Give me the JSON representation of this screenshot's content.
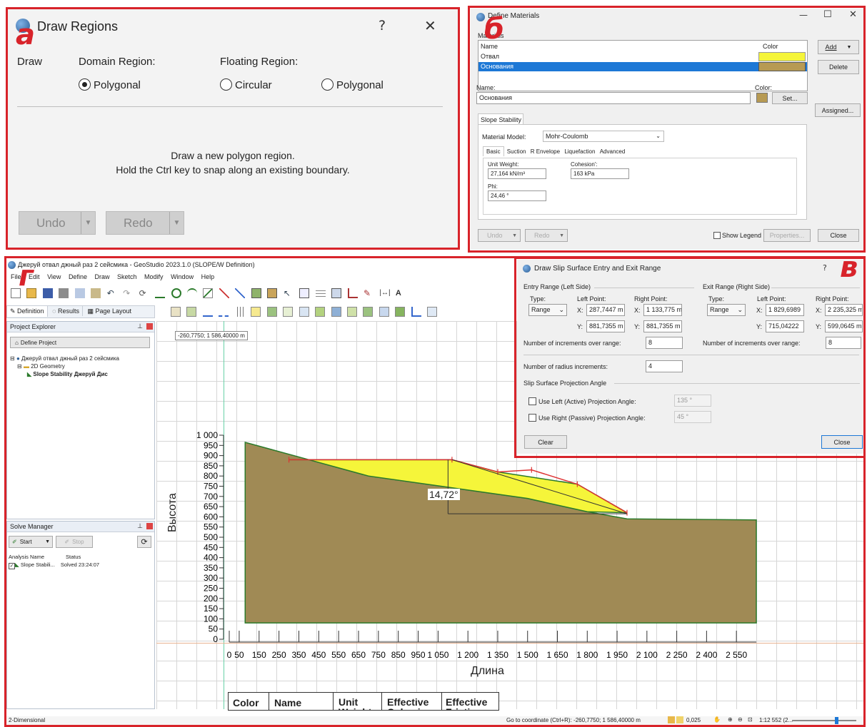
{
  "markers": {
    "a": "а",
    "b": "б",
    "g": "г",
    "v": "в"
  },
  "draw_regions": {
    "title": "Draw Regions",
    "help": "?",
    "close": "✕",
    "draw_label": "Draw",
    "domain_label": "Domain Region:",
    "floating_label": "Floating Region:",
    "opt_domain_polygonal": "Polygonal",
    "opt_circular": "Circular",
    "opt_floating_polygonal": "Polygonal",
    "selected": "domain_polygonal",
    "msg_line1": "Draw a new polygon region.",
    "msg_line2": "Hold the Ctrl key to snap along an existing boundary.",
    "undo": "Undo",
    "redo": "Redo"
  },
  "define_materials": {
    "title": "Define Materials",
    "materials_label": "Materials",
    "col_name": "Name",
    "col_color": "Color",
    "rows": [
      {
        "name": "Отвал",
        "color": "#f5f53a",
        "selected": false
      },
      {
        "name": "Основания",
        "color": "#b79a53",
        "selected": true
      }
    ],
    "add": "Add",
    "delete": "Delete",
    "name_label": "Name:",
    "name_value": "Основания",
    "color_label": "Color:",
    "set": "Set...",
    "assigned": "Assigned...",
    "tab_slope": "Slope Stability",
    "model_label": "Material Model:",
    "model_value": "Mohr-Coulomb",
    "subtabs": [
      "Basic",
      "Suction",
      "R Envelope",
      "Liquefaction",
      "Advanced"
    ],
    "unit_weight_label": "Unit Weight:",
    "unit_weight_value": "27,164 kN/m³",
    "cohesion_label": "Cohesion':",
    "cohesion_value": "163 kPa",
    "phi_label": "Phi:",
    "phi_value": "24,46 °",
    "undo": "Undo",
    "redo": "Redo",
    "show_legend": "Show Legend",
    "properties": "Properties...",
    "close": "Close"
  },
  "geostudio": {
    "title": "Джеруй отвал джный раз 2 сейсмика - GeoStudio 2023.1.0 (SLOPE/W Definition)",
    "menu": [
      "File",
      "Edit",
      "View",
      "Define",
      "Draw",
      "Sketch",
      "Modify",
      "Window",
      "Help"
    ],
    "view_tabs": [
      "Definition",
      "Results",
      "Page Layout"
    ],
    "project_explorer": "Project Explorer",
    "define_project": "Define Project",
    "tree": [
      "Джеруй отвал джный раз 2 сейсмика",
      "2D Geometry",
      "Slope Stability Джеруй Дис"
    ],
    "solve_manager": "Solve Manager",
    "start": "Start",
    "stop": "Stop",
    "col_analysis": "Analysis Name",
    "col_status": "Status",
    "analysis_name": "Slope Stabili...",
    "analysis_status": "Solved 23:24:07",
    "coord_tooltip": "-260,7750; 1 586,40000 m",
    "angle_label": "14,72°",
    "legend_headers": [
      "Color",
      "Name",
      "Unit Weight",
      "Effective Cohesion",
      "Effective Friction"
    ],
    "status_left": "2-Dimensional",
    "status_coord": "Go to coordinate (Ctrl+R): -260,7750; 1 586,40000 m",
    "status_value": "0,025",
    "status_scale": "1:12 552 (2..."
  },
  "chart_data": {
    "type": "area",
    "xlabel": "Длина",
    "ylabel": "Высота",
    "xlim": [
      0,
      2650
    ],
    "ylim": [
      0,
      1000
    ],
    "x_ticks": [
      0,
      50,
      150,
      250,
      350,
      450,
      550,
      650,
      750,
      850,
      950,
      1050,
      1200,
      1350,
      1500,
      1650,
      1800,
      1950,
      2100,
      2250,
      2400,
      2550
    ],
    "y_ticks": [
      0,
      50,
      100,
      150,
      200,
      250,
      300,
      350,
      400,
      450,
      500,
      550,
      600,
      650,
      700,
      750,
      800,
      850,
      900,
      950,
      1000
    ],
    "x_tick_labels": [
      "0",
      "50",
      "150",
      "250",
      "350",
      "450",
      "550",
      "650",
      "750",
      "850",
      "950",
      "1 050",
      "1 200",
      "1 350",
      "1 500",
      "1 650",
      "1 800",
      "1 950",
      "2 100",
      "2 250",
      "2 400",
      "2 550"
    ],
    "y_tick_labels": [
      "0",
      "50",
      "100",
      "150",
      "200",
      "250",
      "300",
      "350",
      "400",
      "450",
      "500",
      "550",
      "600",
      "650",
      "700",
      "750",
      "800",
      "850",
      "900",
      "950",
      "1 000"
    ],
    "regions": [
      {
        "name": "Основания",
        "color": "#a08a55",
        "points": [
          [
            80,
            965
          ],
          [
            400,
            880
          ],
          [
            700,
            800
          ],
          [
            1100,
            745
          ],
          [
            1500,
            690
          ],
          [
            1800,
            625
          ],
          [
            2000,
            590
          ],
          [
            2650,
            585
          ],
          [
            2650,
            80
          ],
          [
            80,
            80
          ]
        ]
      },
      {
        "name": "Отвал",
        "color": "#f5f53a",
        "points": [
          [
            300,
            880
          ],
          [
            1120,
            880
          ],
          [
            1350,
            820
          ],
          [
            1750,
            760
          ],
          [
            2000,
            620
          ],
          [
            1800,
            625
          ],
          [
            1500,
            690
          ],
          [
            1100,
            745
          ],
          [
            700,
            800
          ],
          [
            400,
            880
          ]
        ]
      }
    ],
    "dump_outline": [
      [
        300,
        880
      ],
      [
        1120,
        880
      ],
      [
        1350,
        820
      ],
      [
        1520,
        830
      ],
      [
        1750,
        760
      ],
      [
        2000,
        620
      ]
    ],
    "slope_chord": [
      [
        1120,
        880
      ],
      [
        2000,
        615
      ]
    ],
    "angle_baseline": [
      [
        1100,
        615
      ],
      [
        2000,
        615
      ]
    ]
  },
  "slip_surface": {
    "title": "Draw Slip Surface Entry and Exit Range",
    "help": "?",
    "entry_label": "Entry Range (Left Side)",
    "exit_label": "Exit Range (Right Side)",
    "type_label": "Type:",
    "left_point_label": "Left Point:",
    "right_point_label": "Right Point:",
    "type_value": "Range",
    "entry_left_x": "287,7447 m",
    "entry_left_y": "881,7355 m",
    "entry_right_x": "1 133,775 m",
    "entry_right_y": "881,7355 m",
    "exit_left_x": "1 829,6989",
    "exit_left_y": "715,04222",
    "exit_right_x": "2 235,325 m",
    "exit_right_y": "599,0645 m",
    "increments_label": "Number of increments over range:",
    "entry_increments": "8",
    "exit_increments": "8",
    "radius_label": "Number of radius increments:",
    "radius_value": "4",
    "projection_label": "Slip Surface Projection Angle",
    "left_angle_label": "Use Left (Active) Projection Angle:",
    "left_angle_value": "135 °",
    "right_angle_label": "Use Right (Passive) Projection Angle:",
    "right_angle_value": "45 °",
    "clear": "Clear",
    "close": "Close",
    "x_prefix": "X:",
    "y_prefix": "Y:"
  }
}
